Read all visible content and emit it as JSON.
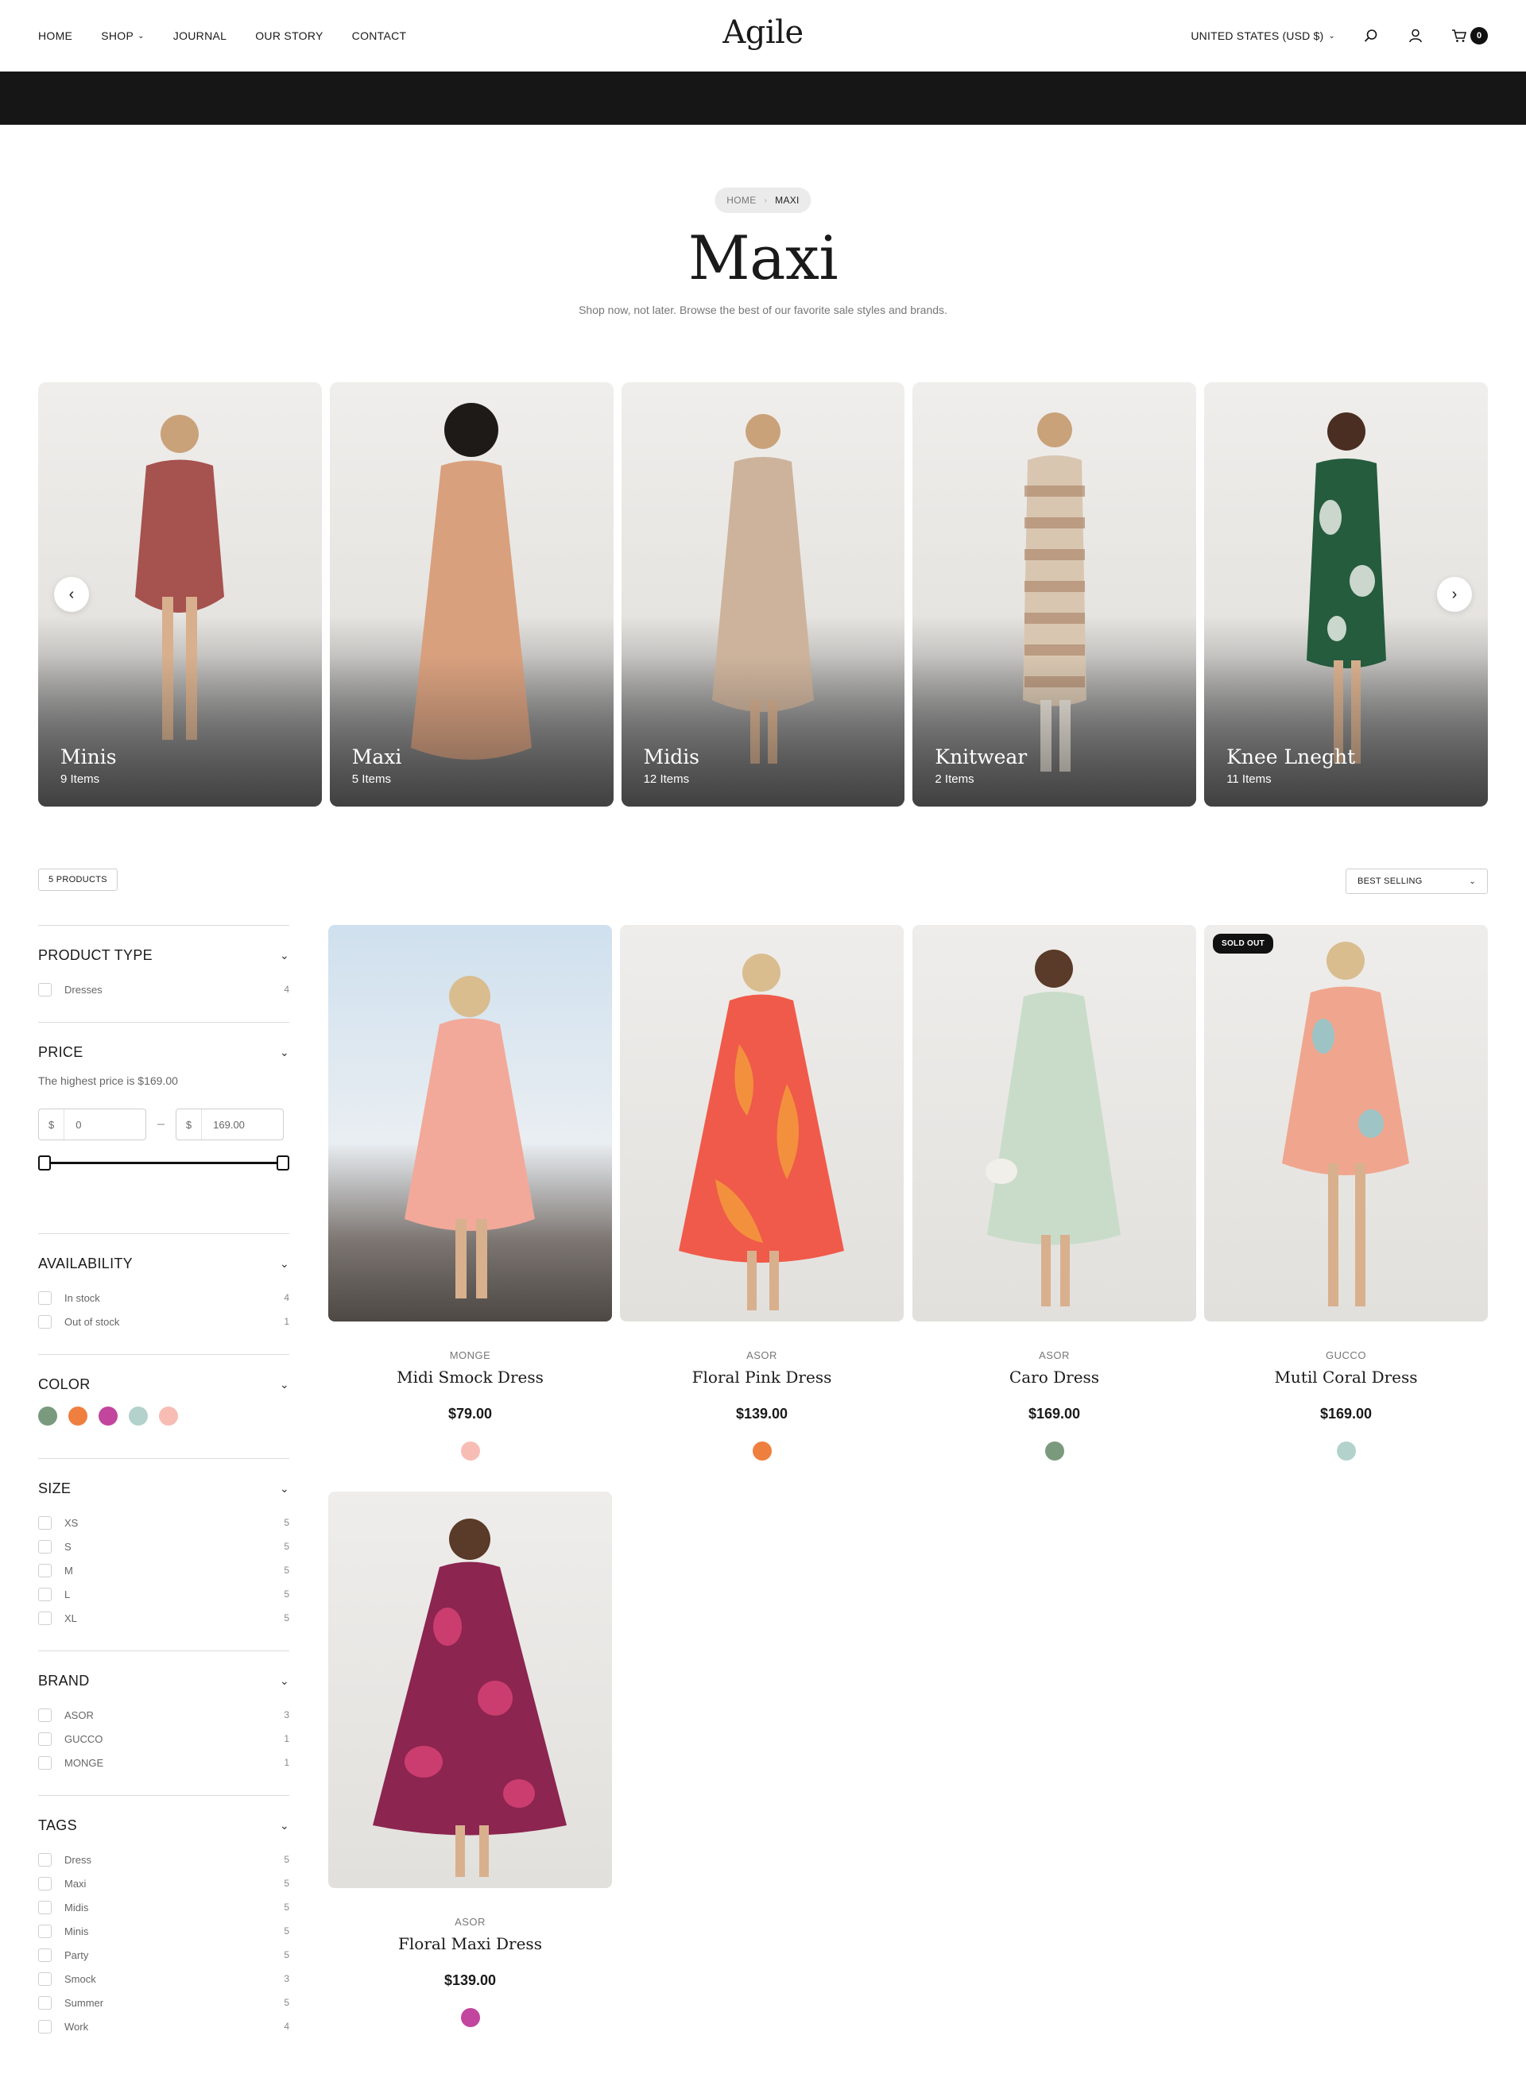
{
  "header": {
    "nav": [
      {
        "label": "HOME"
      },
      {
        "label": "SHOP",
        "has_dropdown": true
      },
      {
        "label": "JOURNAL"
      },
      {
        "label": "OUR STORY"
      },
      {
        "label": "CONTACT"
      }
    ],
    "logo": "Agile",
    "region": "UNITED STATES (USD $)",
    "cart_count": "0"
  },
  "breadcrumb": {
    "home": "HOME",
    "current": "MAXI"
  },
  "page": {
    "title": "Maxi",
    "subtitle": "Shop now, not later. Browse the best of our favorite sale styles and brands."
  },
  "collections": [
    {
      "name": "Minis",
      "count": "9 Items",
      "dress_color": "#a6524f"
    },
    {
      "name": "Maxi",
      "count": "5 Items",
      "dress_color": "#d9a07e"
    },
    {
      "name": "Midis",
      "count": "12 Items",
      "dress_color": "#cdb39c"
    },
    {
      "name": "Knitwear",
      "count": "2 Items",
      "dress_color": "#d8c6b0"
    },
    {
      "name": "Knee Lneght",
      "count": "11 Items",
      "dress_color": "#255c3e"
    }
  ],
  "toolbar": {
    "product_count": "5 PRODUCTS",
    "sort": "BEST SELLING"
  },
  "filters": {
    "product_type": {
      "title": "PRODUCT TYPE",
      "options": [
        {
          "label": "Dresses",
          "count": "4"
        }
      ]
    },
    "price": {
      "title": "PRICE",
      "note": "The highest price is $169.00",
      "currency": "$",
      "min": "0",
      "max": "169.00"
    },
    "availability": {
      "title": "AVAILABILITY",
      "options": [
        {
          "label": "In stock",
          "count": "4"
        },
        {
          "label": "Out of stock",
          "count": "1"
        }
      ]
    },
    "color": {
      "title": "COLOR",
      "swatches": [
        "#7a9a7d",
        "#ef7f3f",
        "#c2459e",
        "#b3d2cc",
        "#f7bdb4"
      ]
    },
    "size": {
      "title": "SIZE",
      "options": [
        {
          "label": "XS",
          "count": "5"
        },
        {
          "label": "S",
          "count": "5"
        },
        {
          "label": "M",
          "count": "5"
        },
        {
          "label": "L",
          "count": "5"
        },
        {
          "label": "XL",
          "count": "5"
        }
      ]
    },
    "brand": {
      "title": "BRAND",
      "options": [
        {
          "label": "ASOR",
          "count": "3"
        },
        {
          "label": "GUCCO",
          "count": "1"
        },
        {
          "label": "MONGE",
          "count": "1"
        }
      ]
    },
    "tags": {
      "title": "TAGS",
      "options": [
        {
          "label": "Dress",
          "count": "5"
        },
        {
          "label": "Maxi",
          "count": "5"
        },
        {
          "label": "Midis",
          "count": "5"
        },
        {
          "label": "Minis",
          "count": "5"
        },
        {
          "label": "Party",
          "count": "5"
        },
        {
          "label": "Smock",
          "count": "3"
        },
        {
          "label": "Summer",
          "count": "5"
        },
        {
          "label": "Work",
          "count": "4"
        }
      ]
    }
  },
  "products": [
    {
      "brand": "MONGE",
      "name": "Midi Smock Dress",
      "price": "$79.00",
      "swatch": "#f7bdb4",
      "dress_color": "#f2a99a"
    },
    {
      "brand": "ASOR",
      "name": "Floral Pink Dress",
      "price": "$139.00",
      "swatch": "#ef7f3f",
      "dress_color": "#f05a4a"
    },
    {
      "brand": "ASOR",
      "name": "Caro Dress",
      "price": "$169.00",
      "swatch": "#7a9a7d",
      "dress_color": "#c9dcc9"
    },
    {
      "brand": "GUCCO",
      "name": "Mutil Coral Dress",
      "price": "$169.00",
      "swatch": "#b3d2cc",
      "dress_color": "#f0a68e",
      "badge": "SOLD OUT"
    },
    {
      "brand": "ASOR",
      "name": "Floral Maxi Dress",
      "price": "$139.00",
      "swatch": "#c2459e",
      "dress_color": "#8c2550"
    }
  ]
}
